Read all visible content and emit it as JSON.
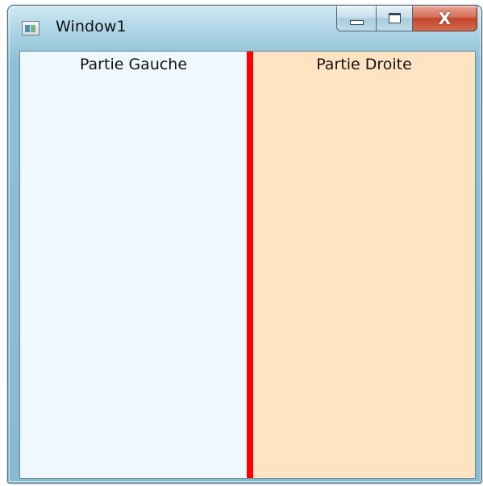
{
  "window": {
    "title": "Window1",
    "icon": "window-app-icon",
    "caption_buttons": {
      "minimize": {
        "glyph": "minimize-icon"
      },
      "maximize": {
        "glyph": "maximize-icon"
      },
      "close": {
        "label": "X",
        "glyph": "close-icon"
      }
    }
  },
  "content": {
    "left_pane": {
      "label": "Partie Gauche",
      "background": "#f0f8ff"
    },
    "splitter": {
      "color": "#ff0000"
    },
    "right_pane": {
      "label": "Partie Droite",
      "background": "#ffe4c4"
    }
  }
}
